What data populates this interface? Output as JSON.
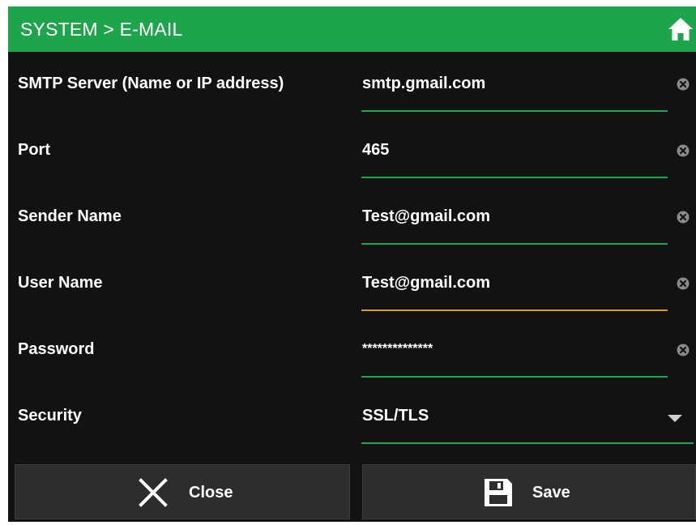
{
  "header": {
    "title": "SYSTEM > E-MAIL",
    "home_icon": "home-icon"
  },
  "fields": [
    {
      "label": "SMTP Server (Name or IP address)",
      "value": "smtp.gmail.com",
      "icon": "clear-icon"
    },
    {
      "label": "Port",
      "value": "465",
      "icon": "clear-icon"
    },
    {
      "label": "Sender Name",
      "value": "Test@gmail.com",
      "icon": "clear-icon"
    },
    {
      "label": "User Name",
      "value": "Test@gmail.com",
      "icon": "clear-icon",
      "focused": true
    },
    {
      "label": "Password",
      "value": "**************",
      "icon": "clear-icon"
    },
    {
      "label": "Security",
      "value": "SSL/TLS",
      "icon": "dropdown-arrow-icon"
    }
  ],
  "buttons": {
    "close": {
      "label": "Close",
      "icon": "close-x-icon"
    },
    "save": {
      "label": "Save",
      "icon": "floppy-disk-icon"
    }
  },
  "colors": {
    "accent": "#1ea54c",
    "focus": "#d6a01e",
    "background": "#121212",
    "button": "#2d2d2d"
  }
}
